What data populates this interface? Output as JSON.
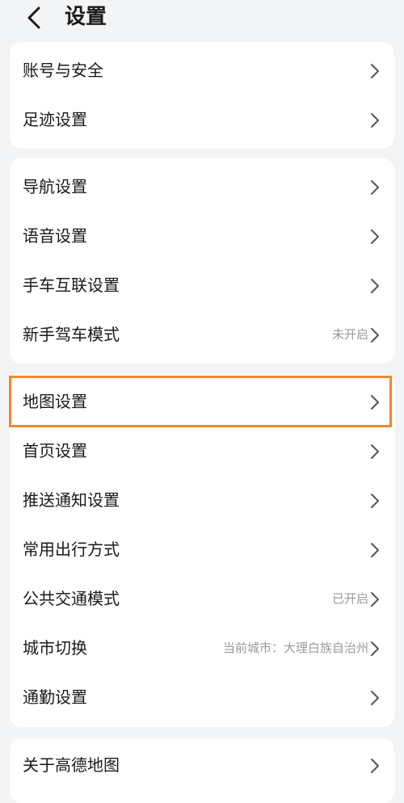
{
  "header": {
    "back_icon": "chevron-left-icon",
    "title": "设置"
  },
  "sections": [
    {
      "items": [
        {
          "label": "账号与安全"
        },
        {
          "label": "足迹设置"
        }
      ]
    },
    {
      "items": [
        {
          "label": "导航设置"
        },
        {
          "label": "语音设置"
        },
        {
          "label": "手车互联设置"
        },
        {
          "label": "新手驾车模式",
          "value": "未开启"
        }
      ]
    },
    {
      "items": [
        {
          "label": "地图设置",
          "highlighted": true
        },
        {
          "label": "首页设置"
        },
        {
          "label": "推送通知设置"
        },
        {
          "label": "常用出行方式"
        },
        {
          "label": "公共交通模式",
          "value": "已开启"
        },
        {
          "label": "城市切换",
          "value": "当前城市：大理白族自治州"
        },
        {
          "label": "通勤设置"
        }
      ]
    },
    {
      "items": [
        {
          "label": "关于高德地图"
        }
      ]
    }
  ],
  "colors": {
    "background": "#f3f4f6",
    "card": "#ffffff",
    "highlight": "#f0892e",
    "secondary_text": "#9a9a9a"
  }
}
